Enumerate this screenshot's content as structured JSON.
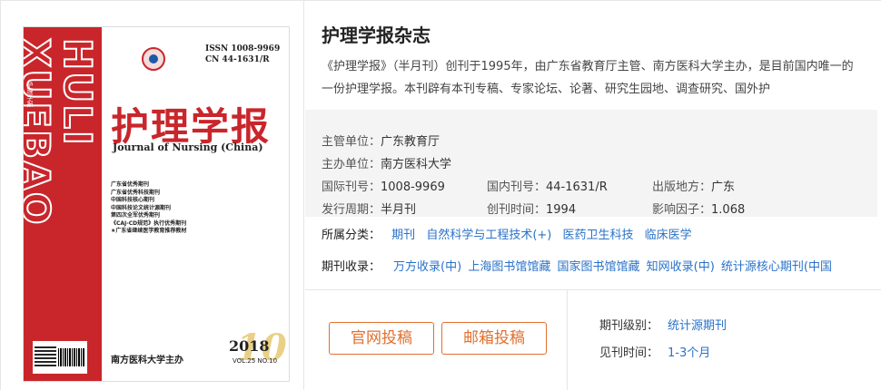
{
  "cover": {
    "spine_text": "HULI XUEBAO",
    "spine_minor": "护理学报",
    "issn": "ISSN 1008-9969",
    "cn": "CN 44-1631/R",
    "cn_title": "护理学报",
    "en_title": "Journal of Nursing (China)",
    "honors": [
      "广东省优秀期刊",
      "广东省优秀科技期刊",
      "中国科技核心期刊",
      "中国科技论文统计源期刊",
      "第四次全军优秀期刊",
      "《CAJ-CD规范》执行优秀期刊",
      "★广东省继续医学教育推荐教材"
    ],
    "big_num": "10",
    "year": "2018",
    "vol": "VOL.25 NO.10",
    "publisher": "南方医科大学主办"
  },
  "journal": {
    "title": "护理学报杂志",
    "description": "《护理学报》（半月刊）创刊于1995年，由广东省教育厅主管、南方医科大学主办，是目前国内唯一的一份护理学报。本刊辟有本刊专稿、专家论坛、论著、研究生园地、调查研究、国外护"
  },
  "meta": {
    "sponsor_label": "主管单位：",
    "sponsor": "广东教育厅",
    "host_label": "主办单位：",
    "host": "南方医科大学",
    "issn_label": "国际刊号：",
    "issn": "1008-9969",
    "cn_label": "国内刊号：",
    "cn": "44-1631/R",
    "place_label": "出版地方：",
    "place": "广东",
    "freq_label": "发行周期：",
    "freq": "半月刊",
    "founded_label": "创刊时间：",
    "founded": "1994",
    "impact_label": "影响因子：",
    "impact": "1.068"
  },
  "categories": {
    "label": "所属分类：",
    "items": [
      "期刊",
      "自然科学与工程技术(+)",
      "医药卫生科技",
      "临床医学"
    ]
  },
  "collections": {
    "label": "期刊收录：",
    "items": [
      "万方收录(中)",
      "上海图书馆馆藏",
      "国家图书馆馆藏",
      "知网收录(中)",
      "统计源核心期刊(中国"
    ]
  },
  "actions": {
    "official_submit": "官网投稿",
    "email_submit": "邮箱投稿"
  },
  "stats": {
    "level_label": "期刊级别：",
    "level": "统计源期刊",
    "time_label": "见刊时间：",
    "time": "1-3个月"
  },
  "colors": {
    "brand_red": "#c9262b",
    "link_blue": "#2a72c8",
    "button_orange": "#e07030"
  }
}
